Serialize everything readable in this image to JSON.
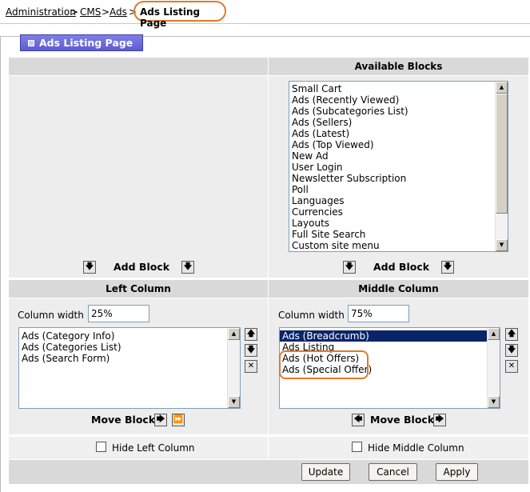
{
  "breadcrumb": {
    "administration": "Administration",
    "sep1": ">",
    "cms": "CMS",
    "sep2": ">",
    "ads": "Ads",
    "sep3": ">",
    "current": "Ads Listing Page"
  },
  "tab_title": "Ads Listing Page",
  "available_blocks": {
    "header": "Available Blocks",
    "items": [
      "Small Cart",
      "Ads (Recently Viewed)",
      "Ads (Subcategories List)",
      "Ads (Sellers)",
      "Ads (Latest)",
      "Ads (Top Viewed)",
      "New Ad",
      "User Login",
      "Newsletter Subscription",
      "Poll",
      "Languages",
      "Currencies",
      "Layouts",
      "Full Site Search",
      "Custom site menu"
    ]
  },
  "add_block_label": "Add Block",
  "left_column": {
    "header": "Left Column",
    "width_label": "Column width",
    "width_value": "25%",
    "items": [
      "Ads (Category Info)",
      "Ads (Categories List)",
      "Ads (Search Form)"
    ],
    "move_label": "Move Block",
    "hide_label": "Hide Left Column"
  },
  "middle_column": {
    "header": "Middle Column",
    "width_label": "Column width",
    "width_value": "75%",
    "items": [
      "Ads (Breadcrumb)",
      "Ads Listing",
      "Ads (Hot Offers)",
      "Ads (Special Offer)"
    ],
    "selected_index": 0,
    "move_label": "Move Block",
    "hide_label": "Hide Middle Column"
  },
  "buttons": {
    "update": "Update",
    "cancel": "Cancel",
    "apply": "Apply"
  },
  "colors": {
    "highlight": "#e07a2c",
    "tab": "#5b5bd0",
    "selection": "#0a246a"
  }
}
